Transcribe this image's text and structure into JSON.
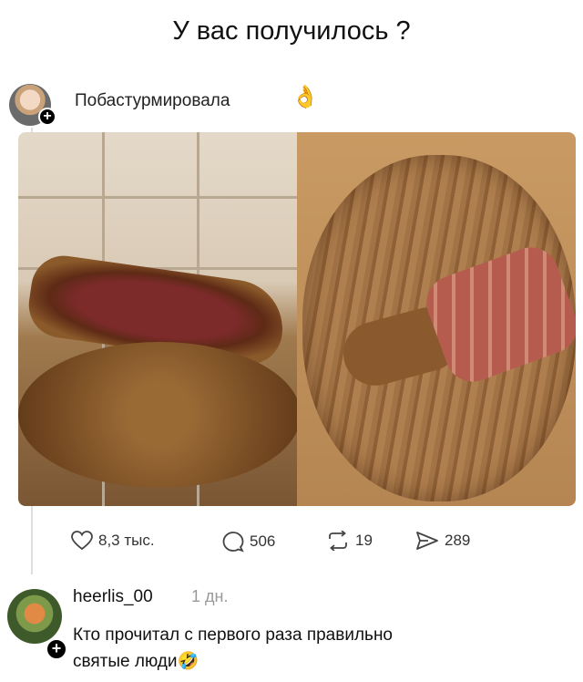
{
  "meme_title": "У вас получилось ?",
  "post": {
    "username": "Побастурмировала",
    "emoji": "👌",
    "plus": "+"
  },
  "photos": {
    "left": "meat-slab-photo",
    "right": "cutting-board-photo"
  },
  "actions": {
    "likes": "8,3 тыс.",
    "replies": "506",
    "reposts": "19",
    "shares": "289"
  },
  "comment": {
    "username": "heerlis_00",
    "time": "1 дн.",
    "plus": "+",
    "line1": "Кто прочитал с первого раза правильно",
    "line2": "святые люди",
    "emoji": "🤣"
  }
}
